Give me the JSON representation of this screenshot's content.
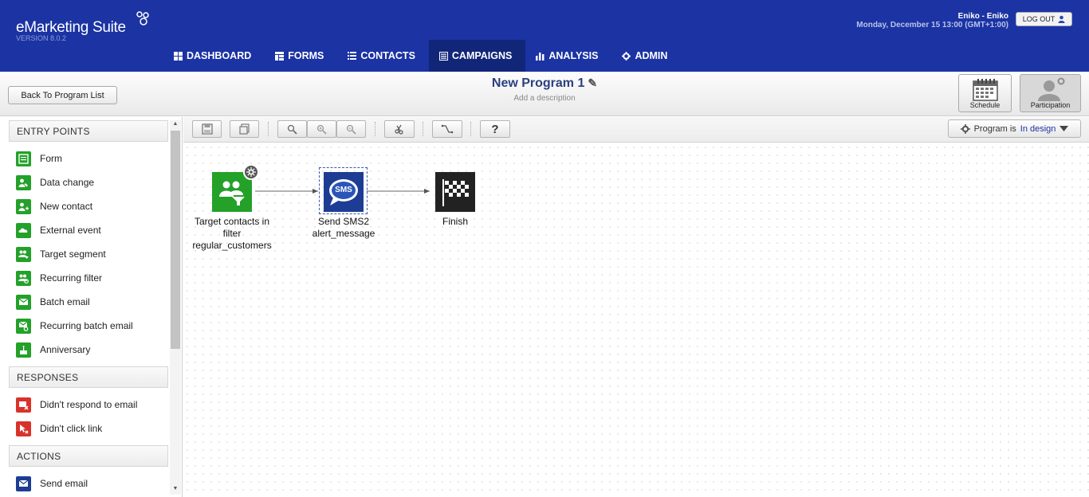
{
  "header": {
    "brand": "eMarketing Suite",
    "version": "VERSION 8.0.2",
    "user": "Eniko - Eniko",
    "date": "Monday, December 15 13:00 (GMT+1:00)",
    "logout": "LOG OUT"
  },
  "nav": {
    "dashboard": "DASHBOARD",
    "forms": "FORMS",
    "contacts": "CONTACTS",
    "campaigns": "CAMPAIGNS",
    "analysis": "ANALYSIS",
    "admin": "ADMIN"
  },
  "subheader": {
    "back": "Back To Program List",
    "title": "New Program 1",
    "description": "Add a description",
    "schedule": "Schedule",
    "participation": "Participation"
  },
  "sidebar": {
    "entry_points": {
      "title": "ENTRY POINTS",
      "items": [
        "Form",
        "Data change",
        "New contact",
        "External event",
        "Target segment",
        "Recurring filter",
        "Batch email",
        "Recurring batch email",
        "Anniversary"
      ]
    },
    "responses": {
      "title": "RESPONSES",
      "items": [
        "Didn't respond to email",
        "Didn't click link"
      ]
    },
    "actions": {
      "title": "ACTIONS",
      "items": [
        "Send email"
      ]
    }
  },
  "toolbar": {
    "help": "?",
    "status_prefix": "Program is",
    "status_value": "In design"
  },
  "flow": {
    "nodes": [
      {
        "line1": "Target contacts in",
        "line2": "filter",
        "line3": "regular_customers"
      },
      {
        "icon_text": "SMS",
        "line1": "Send SMS2",
        "line2": "alert_message"
      },
      {
        "line1": "Finish"
      }
    ]
  },
  "colors": {
    "header_bg": "#1b33a3",
    "nav_active": "#122679",
    "entry_green": "#23a129",
    "response_red": "#d9322a",
    "action_blue": "#1d3c94"
  }
}
